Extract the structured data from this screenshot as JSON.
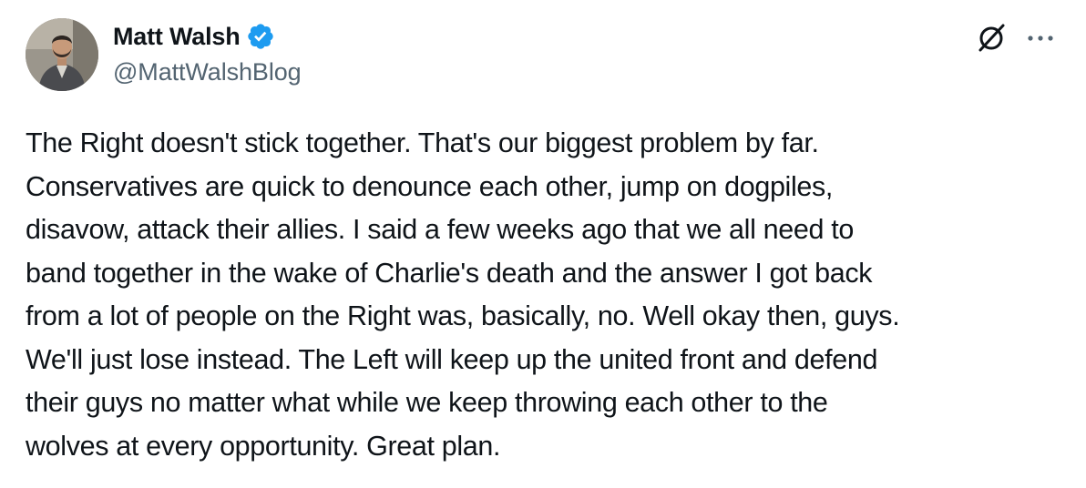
{
  "author": {
    "display_name": "Matt Walsh",
    "handle": "@MattWalshBlog",
    "verified": true,
    "verified_color": "#1d9bf0"
  },
  "actions": {
    "grok_icon": "grok-icon",
    "more_icon": "more-icon"
  },
  "tweet": {
    "lines": [
      "The Right doesn't stick together. That's our biggest problem by far.",
      "Conservatives are quick to denounce each other, jump on dogpiles,",
      "disavow, attack their allies. I said a few weeks ago that we all need to",
      "band together in the wake of Charlie's death and the answer I got back",
      "from a lot of people on the Right was, basically, no. Well okay then, guys.",
      "We'll just lose instead. The Left will keep up the united front and defend",
      "their guys no matter what while we keep throwing each other to the",
      "wolves at every opportunity. Great plan."
    ]
  },
  "colors": {
    "text_primary": "#0f1419",
    "text_secondary": "#536471",
    "background": "#ffffff"
  }
}
